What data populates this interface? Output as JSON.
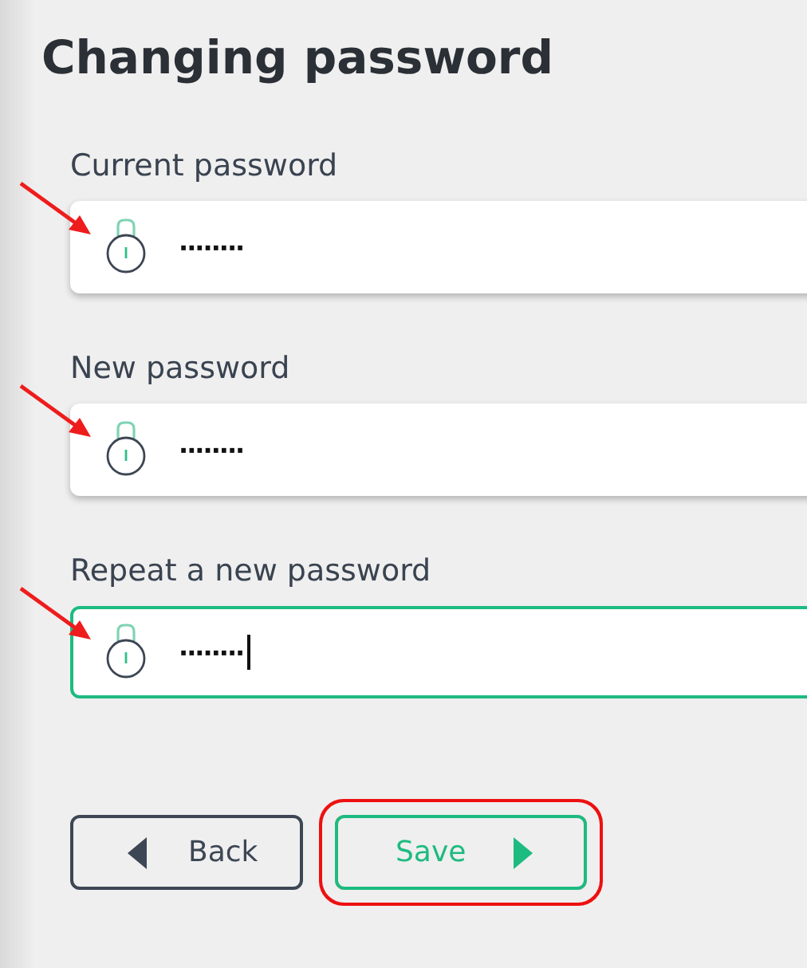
{
  "title": "Changing password",
  "fields": [
    {
      "label": "Current password",
      "value": "········",
      "focused": false,
      "marked_by_arrow": true
    },
    {
      "label": "New password",
      "value": "········",
      "focused": false,
      "marked_by_arrow": true
    },
    {
      "label": "Repeat a new password",
      "value": "········",
      "focused": true,
      "marked_by_arrow": true
    }
  ],
  "buttons": [
    {
      "label": "Back",
      "kind": "back"
    },
    {
      "label": "Save",
      "kind": "forward",
      "highlighted": true
    }
  ]
}
